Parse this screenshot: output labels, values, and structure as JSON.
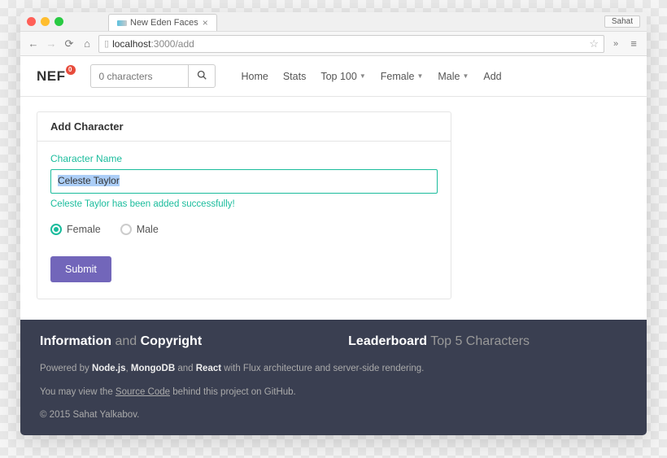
{
  "browser": {
    "tab_title": "New Eden Faces",
    "user_chip": "Sahat",
    "url_host": "localhost",
    "url_port_path": ":3000/add"
  },
  "brand": {
    "text": "NEF",
    "badge": "0"
  },
  "search": {
    "placeholder": "0 characters"
  },
  "nav": {
    "home": "Home",
    "stats": "Stats",
    "top100": "Top 100",
    "female": "Female",
    "male": "Male",
    "add": "Add"
  },
  "panel": {
    "heading": "Add Character",
    "label": "Character Name",
    "input_value": "Celeste Taylor",
    "help_text": "Celeste Taylor has been added successfully!",
    "radio_female": "Female",
    "radio_male": "Male",
    "submit": "Submit"
  },
  "footer": {
    "info_heading_strong1": "Information",
    "info_heading_mid": " and ",
    "info_heading_strong2": "Copyright",
    "leader_heading_strong": "Leaderboard",
    "leader_heading_muted": " Top 5 Characters",
    "powered_pre": "Powered by ",
    "powered_node": "Node.js",
    "powered_sep1": ", ",
    "powered_mongo": "MongoDB",
    "powered_sep2": " and ",
    "powered_react": "React",
    "powered_post": " with Flux architecture and server-side rendering.",
    "source_pre": "You may view the ",
    "source_link": "Source Code",
    "source_post": " behind this project on GitHub.",
    "copyright": "© 2015 Sahat Yalkabov."
  }
}
